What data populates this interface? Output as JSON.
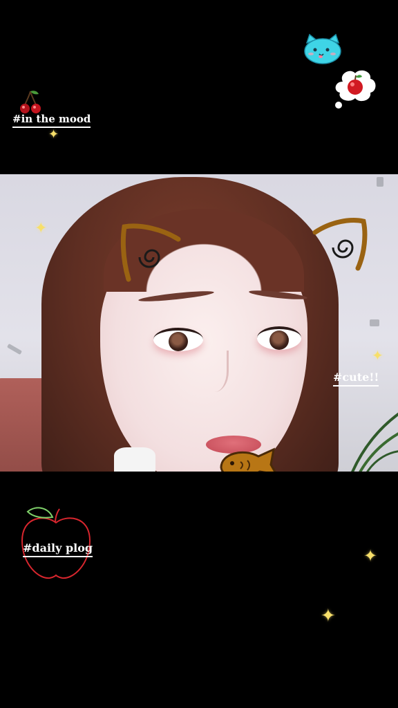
{
  "stickers": {
    "top_left_tag": "#in the mood",
    "photo_tag": "#cute!!",
    "bottom_tag": "#daily plog"
  },
  "colors": {
    "background": "#000000",
    "sparkle": "#f7df6a",
    "apple_outline": "#d8262e",
    "cat_ear": "#9a6312"
  },
  "icons": [
    "cherry-icon",
    "cat-face-icon",
    "apple-thought-bubble-icon",
    "sparkle-icon",
    "apple-outline-icon",
    "cat-ear-icon",
    "taiyaki-fish-icon"
  ]
}
